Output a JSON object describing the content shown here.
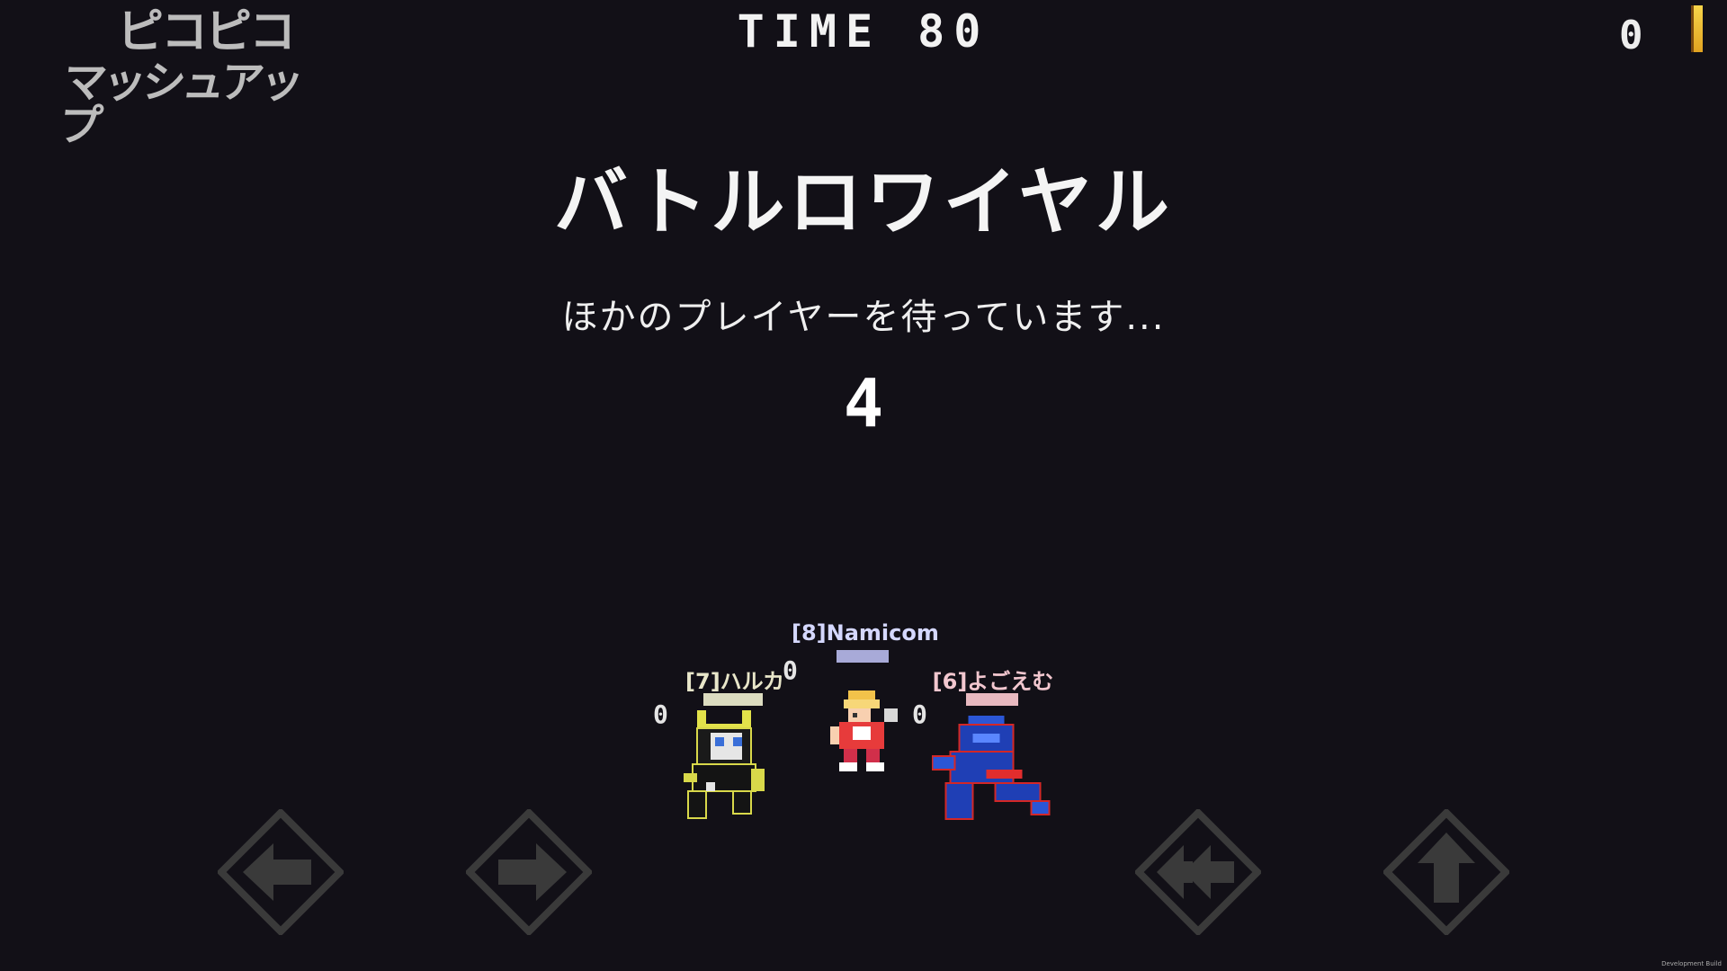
{
  "logo": {
    "line1": "ピコピコ",
    "line2": "マッシュアップ"
  },
  "hud": {
    "timer": "TIME 80",
    "score": "0"
  },
  "lobby": {
    "mode_title": "バトルロワイヤル",
    "waiting_text": "ほかのプレイヤーを待っています...",
    "countdown": "4"
  },
  "players": [
    {
      "tag": "[8]Namicom",
      "score": "0",
      "tag_color": "#d5d8ff",
      "bar_color": "#a8aad8"
    },
    {
      "tag": "[7]ハルカ",
      "score": "0",
      "tag_color": "#e8e6c9",
      "bar_color": "#dcdcc0"
    },
    {
      "tag": "[6]よごえむ",
      "score": "0",
      "tag_color": "#f2c7cf",
      "bar_color": "#e8b9c0"
    }
  ],
  "controls": [
    {
      "name": "left-arrow-button",
      "icon": "arrow-left-icon"
    },
    {
      "name": "right-arrow-button",
      "icon": "arrow-right-icon"
    },
    {
      "name": "dash-left-button",
      "icon": "double-arrow-left-icon"
    },
    {
      "name": "up-arrow-button",
      "icon": "arrow-up-icon"
    }
  ],
  "footer": {
    "build_label": "Development Build"
  },
  "colors": {
    "background": "#121017",
    "hud_text": "#f2f2f2",
    "button_fill": "#3a3a3a"
  }
}
